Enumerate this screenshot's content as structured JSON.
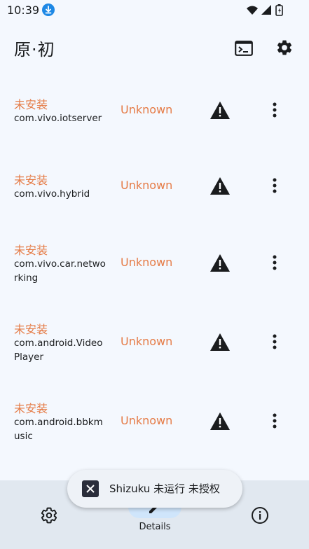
{
  "status_bar": {
    "time": "10:39",
    "icons": [
      "download-icon",
      "wifi-icon",
      "cellular-icon",
      "battery-icon"
    ]
  },
  "app_bar": {
    "title": "原·初",
    "actions": [
      "terminal-icon",
      "settings-icon"
    ]
  },
  "apps": [
    {
      "status": "未安装",
      "package": "com.vivo.iotserver",
      "version": "Unknown",
      "icons": [
        "warning-icon",
        "more-vert-icon"
      ]
    },
    {
      "status": "未安装",
      "package": "com.vivo.hybrid",
      "version": "Unknown",
      "icons": [
        "warning-icon",
        "more-vert-icon"
      ]
    },
    {
      "status": "未安装",
      "package": "com.vivo.car.networking",
      "version": "Unknown",
      "icons": [
        "warning-icon",
        "more-vert-icon"
      ]
    },
    {
      "status": "未安装",
      "package": "com.android.VideoPlayer",
      "version": "Unknown",
      "icons": [
        "warning-icon",
        "more-vert-icon"
      ]
    },
    {
      "status": "未安装",
      "package": "com.android.bbkmusic",
      "version": "Unknown",
      "icons": [
        "warning-icon",
        "more-vert-icon"
      ]
    }
  ],
  "bottom_nav": {
    "items": [
      {
        "icon": "settings-icon",
        "label": ""
      },
      {
        "icon": "details-icon",
        "label": "Details",
        "selected": true
      },
      {
        "icon": "info-icon",
        "label": ""
      }
    ]
  },
  "snackbar": {
    "icon": "shizuku-icon",
    "text": "Shizuku 未运行 未授权"
  },
  "colors": {
    "accent_orange": "#e57b46",
    "background": "#f4f8fe",
    "nav_background": "#e1e8f0",
    "nav_indicator": "#cfe5fb"
  }
}
